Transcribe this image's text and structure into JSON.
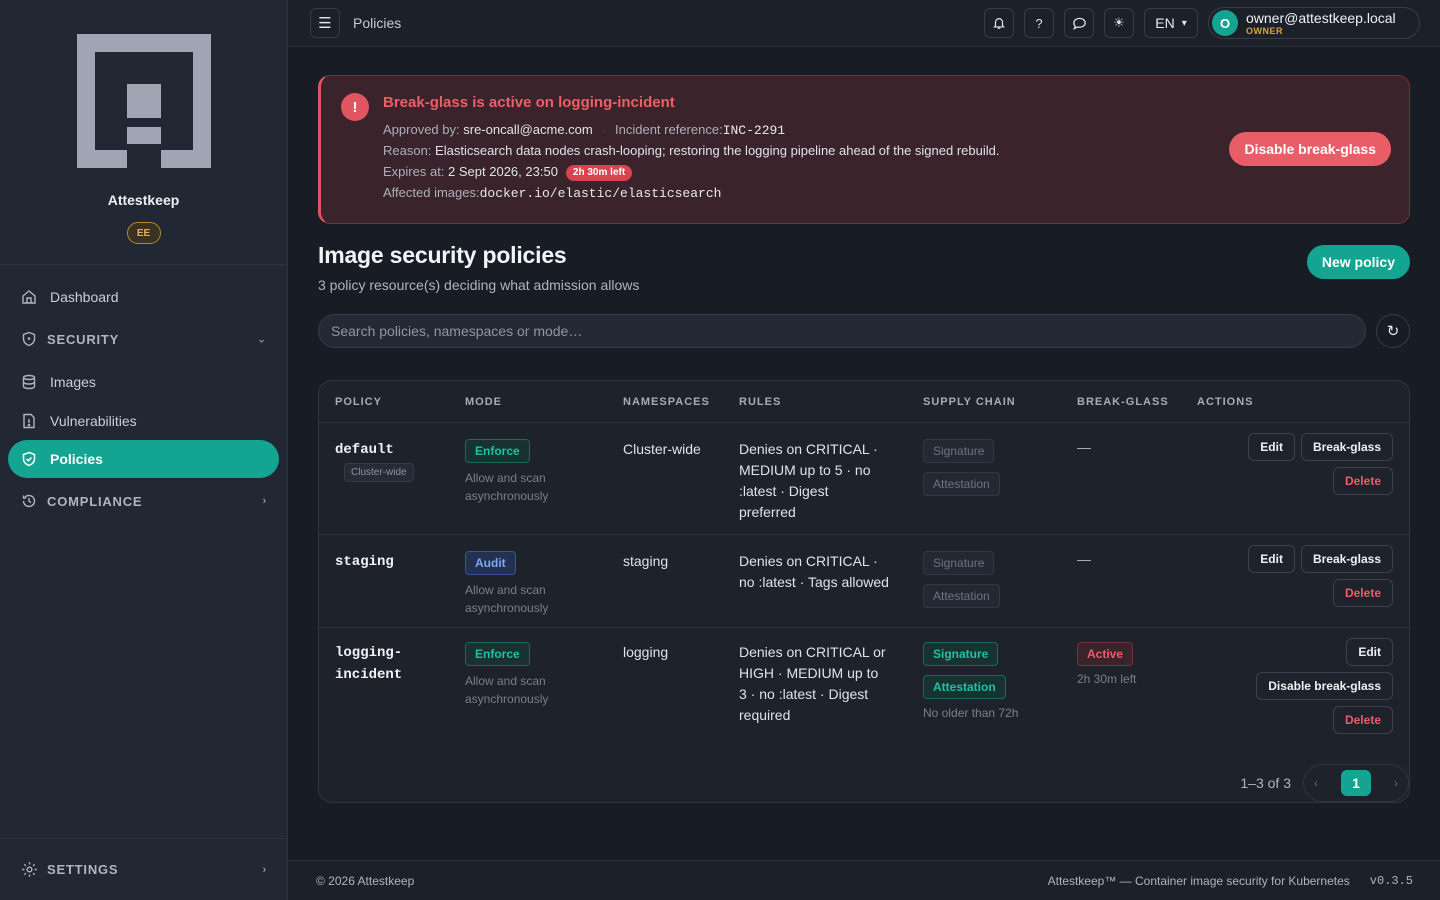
{
  "app": {
    "name": "Attestkeep",
    "edition_badge": "EE"
  },
  "sidebar": {
    "dashboard": "Dashboard",
    "security_section": "SECURITY",
    "images": "Images",
    "vulnerabilities": "Vulnerabilities",
    "policies": "Policies",
    "compliance_section": "COMPLIANCE",
    "settings": "SETTINGS"
  },
  "topbar": {
    "breadcrumb": "Policies",
    "language": "EN",
    "user_initial": "O",
    "user_email": "owner@attestkeep.local",
    "user_role": "OWNER"
  },
  "alert": {
    "title": "Break-glass is active on logging-incident",
    "approved_label": "Approved by:",
    "approved_by": "sre-oncall@acme.com",
    "incident_label": "Incident reference:",
    "incident_ref": "INC-2291",
    "reason_label": "Reason:",
    "reason": "Elasticsearch data nodes crash-looping; restoring the logging pipeline ahead of the signed rebuild.",
    "expires_label": "Expires at:",
    "expires_at": "2 Sept 2026, 23:50",
    "time_left": "2h 30m left",
    "images_label": "Affected images:",
    "images": "docker.io/elastic/elasticsearch",
    "disable_button": "Disable break-glass"
  },
  "page": {
    "title": "Image security policies",
    "subtitle": "3 policy resource(s) deciding what admission allows",
    "new_policy_button": "New policy",
    "search_placeholder": "Search policies, namespaces or mode…"
  },
  "table": {
    "headers": [
      "POLICY",
      "MODE",
      "NAMESPACES",
      "RULES",
      "SUPPLY CHAIN",
      "BREAK-GLASS",
      "ACTIONS"
    ],
    "rows": [
      {
        "name": "default",
        "tag": "Cluster-wide",
        "mode": "Enforce",
        "mode_desc": "Allow and scan asynchronously",
        "namespaces": "Cluster-wide",
        "rules": "Denies on CRITICAL · MEDIUM up to 5 · no :latest · Digest preferred",
        "sig": "Signature",
        "att": "Attestation",
        "sc_note": "",
        "breakglass": "—",
        "bg_note": "",
        "edit": "Edit",
        "bg_action": "Break-glass",
        "delete": "Delete"
      },
      {
        "name": "staging",
        "tag": "",
        "mode": "Audit",
        "mode_desc": "Allow and scan asynchronously",
        "namespaces": "staging",
        "rules": "Denies on CRITICAL · no :latest · Tags allowed",
        "sig": "Signature",
        "att": "Attestation",
        "sc_note": "",
        "breakglass": "—",
        "bg_note": "",
        "edit": "Edit",
        "bg_action": "Break-glass",
        "delete": "Delete"
      },
      {
        "name": "logging-incident",
        "tag": "",
        "mode": "Enforce",
        "mode_desc": "Allow and scan asynchronously",
        "namespaces": "logging",
        "rules": "Denies on CRITICAL or HIGH · MEDIUM up to 3 · no :latest · Digest required",
        "sig": "Signature",
        "att": "Attestation",
        "sc_note": "No older than 72h",
        "breakglass": "Active",
        "bg_note": "2h 30m left",
        "edit": "Edit",
        "bg_action": "Disable break-glass",
        "delete": "Delete"
      }
    ],
    "pagination": {
      "range": "1–3 of 3",
      "current": "1",
      "prev": "‹",
      "next": "›"
    }
  },
  "footer": {
    "copyright": "© 2026 Attestkeep",
    "tagline": "Attestkeep™ — Container image security for Kubernetes",
    "version": "v0.3.5"
  },
  "colors": {
    "accent": "#13a591",
    "danger": "#e05560",
    "warning": "#d9a441"
  }
}
